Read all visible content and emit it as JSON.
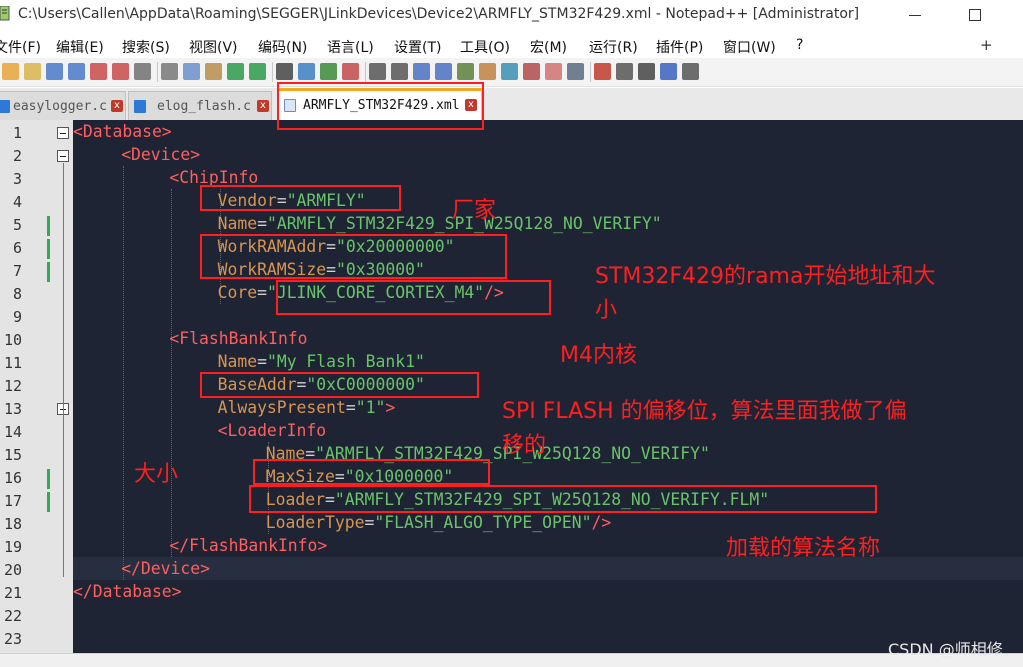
{
  "window": {
    "title": "C:\\Users\\Callen\\AppData\\Roaming\\SEGGER\\JLinkDevices\\Device2\\ARMFLY_STM32F429.xml - Notepad++ [Administrator]"
  },
  "menu": {
    "items": [
      "文件(F)",
      "编辑(E)",
      "搜索(S)",
      "视图(V)",
      "编码(N)",
      "语言(L)",
      "设置(T)",
      "工具(O)",
      "宏(M)",
      "运行(R)",
      "插件(P)",
      "窗口(W)",
      "?"
    ],
    "right": "+"
  },
  "toolbar": {
    "icons": [
      "new-file-icon",
      "open-file-icon",
      "save-icon",
      "save-all-icon",
      "close-icon",
      "close-all-icon",
      "print-icon",
      "cut-icon",
      "copy-icon",
      "paste-icon",
      "undo-icon",
      "redo-icon",
      "find-icon",
      "replace-icon",
      "zoom-in-icon",
      "zoom-out-icon",
      "sync-v-icon",
      "sync-h-icon",
      "word-wrap-icon",
      "show-all-chars-icon",
      "indent-guide-icon",
      "udl-icon",
      "doc-map-icon",
      "function-list-icon",
      "folder-workspace-icon",
      "monitor-icon",
      "record-macro-icon",
      "stop-record-icon",
      "play-macro-icon",
      "run-macro-multiple-icon",
      "save-macro-icon"
    ]
  },
  "tabs": [
    {
      "label": "easylogger.c",
      "close": "x",
      "active": false
    },
    {
      "label": "elog_flash.c",
      "close": "x",
      "active": false
    },
    {
      "label": "ARMFLY_STM32F429.xml",
      "close": "x",
      "active": true
    }
  ],
  "editor": {
    "line_numbers": [
      "1",
      "2",
      "3",
      "4",
      "5",
      "6",
      "7",
      "8",
      "9",
      "10",
      "11",
      "12",
      "13",
      "14",
      "15",
      "16",
      "17",
      "18",
      "19",
      "20",
      "21",
      "22",
      "23"
    ],
    "lines": [
      [
        {
          "c": "t",
          "s": "<Database>"
        }
      ],
      [
        {
          "c": "t",
          "s": "<Device>"
        }
      ],
      [
        {
          "c": "t",
          "s": "<ChipInfo"
        }
      ],
      [
        {
          "c": "a",
          "s": "Vendor"
        },
        {
          "c": "p",
          "s": "="
        },
        {
          "c": "v",
          "s": "\"ARMFLY\""
        }
      ],
      [
        {
          "c": "a",
          "s": "Name"
        },
        {
          "c": "p",
          "s": "="
        },
        {
          "c": "v",
          "s": "\"ARMFLY_STM32F429_SPI_W25Q128_NO_VERIFY\""
        }
      ],
      [
        {
          "c": "a",
          "s": "WorkRAMAddr"
        },
        {
          "c": "p",
          "s": "="
        },
        {
          "c": "v",
          "s": "\"0x20000000\""
        }
      ],
      [
        {
          "c": "a",
          "s": "WorkRAMSize"
        },
        {
          "c": "p",
          "s": "="
        },
        {
          "c": "v",
          "s": "\"0x30000\""
        }
      ],
      [
        {
          "c": "a",
          "s": "Core"
        },
        {
          "c": "p",
          "s": "="
        },
        {
          "c": "v",
          "s": "\"JLINK_CORE_CORTEX_M4\""
        },
        {
          "c": "t",
          "s": "/>"
        }
      ],
      [],
      [
        {
          "c": "t",
          "s": "<FlashBankInfo"
        }
      ],
      [
        {
          "c": "a",
          "s": "Name"
        },
        {
          "c": "p",
          "s": "="
        },
        {
          "c": "v",
          "s": "\"My Flash Bank1\""
        }
      ],
      [
        {
          "c": "a",
          "s": "BaseAddr"
        },
        {
          "c": "p",
          "s": "="
        },
        {
          "c": "v",
          "s": "\"0xC0000000\""
        }
      ],
      [
        {
          "c": "a",
          "s": "AlwaysPresent"
        },
        {
          "c": "p",
          "s": "="
        },
        {
          "c": "v",
          "s": "\"1\""
        },
        {
          "c": "t",
          "s": ">"
        }
      ],
      [
        {
          "c": "t",
          "s": "<LoaderInfo"
        }
      ],
      [
        {
          "c": "a",
          "s": "Name"
        },
        {
          "c": "p",
          "s": "="
        },
        {
          "c": "v",
          "s": "\"ARMFLY_STM32F429_SPI_W25Q128_NO_VERIFY\""
        }
      ],
      [
        {
          "c": "a",
          "s": "MaxSize"
        },
        {
          "c": "p",
          "s": "="
        },
        {
          "c": "v",
          "s": "\"0x1000000\""
        }
      ],
      [
        {
          "c": "a",
          "s": "Loader"
        },
        {
          "c": "p",
          "s": "="
        },
        {
          "c": "v",
          "s": "\"ARMFLY_STM32F429_SPI_W25Q128_NO_VERIFY.FLM\""
        }
      ],
      [
        {
          "c": "a",
          "s": "LoaderType"
        },
        {
          "c": "p",
          "s": "="
        },
        {
          "c": "v",
          "s": "\"FLASH_ALGO_TYPE_OPEN\""
        },
        {
          "c": "t",
          "s": "/>"
        }
      ],
      [
        {
          "c": "t",
          "s": "</FlashBankInfo>"
        }
      ],
      [
        {
          "c": "t",
          "s": "</Device>"
        }
      ],
      [
        {
          "c": "t",
          "s": "</Database>"
        }
      ],
      [],
      []
    ]
  },
  "annotations": {
    "vendor": "厂家",
    "ram_line1": "STM32F429的rama开始地址和大",
    "ram_line2": "小",
    "core": "M4内核",
    "offset_line1": "SPI FLASH 的偏移位，算法里面我做了偏",
    "offset_line2": "移的",
    "size": "大小",
    "loader": "加载的算法名称"
  },
  "watermark": "CSDN @师相修",
  "colors": {
    "editor_bg": "#1e2434",
    "tag": "#ff5f5f",
    "attribute": "#d89552",
    "value": "#6ac36a",
    "annotation": "#ff1f1f",
    "active_tab_accent": "#f5a623"
  }
}
